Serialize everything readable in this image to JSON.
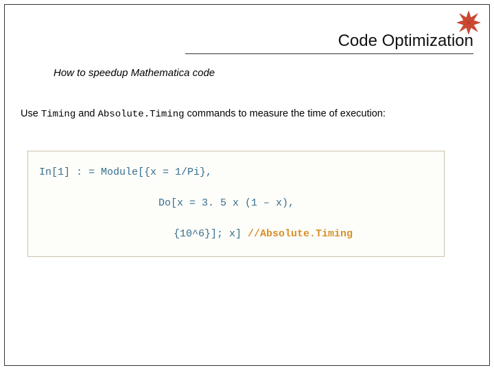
{
  "header": {
    "title": "Code Optimization",
    "logo_name": "mathematica-spikey-logo"
  },
  "subtitle": "How to speedup Mathematica code",
  "body": {
    "prefix": "Use ",
    "cmd1": "Timing",
    "mid": " and ",
    "cmd2": "Absolute.Timing",
    "suffix": " commands to measure the time of execution:"
  },
  "code": {
    "line1": "In[1] : = Module[{x = 1/Pi},",
    "line2": "Do[x = 3. 5 x (1 – x),",
    "line3_plain": "{10^6}]; x] ",
    "line3_postfix": "//Absolute.Timing"
  }
}
